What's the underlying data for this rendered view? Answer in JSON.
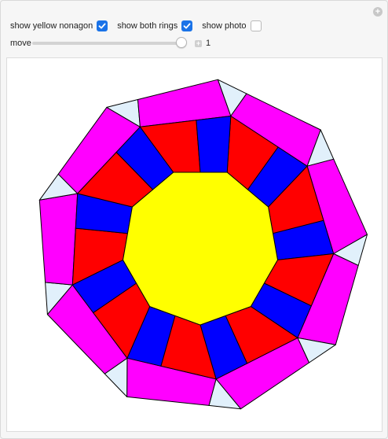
{
  "controls": {
    "nonagon": {
      "label": "show yellow nonagon",
      "checked": true
    },
    "rings": {
      "label": "show both rings",
      "checked": true
    },
    "photo": {
      "label": "show photo",
      "checked": false
    }
  },
  "slider": {
    "label": "move",
    "value": "1",
    "position": 1.0
  },
  "colors": {
    "yellow": "#ffff00",
    "red": "#ff0000",
    "blue": "#0000ff",
    "magenta": "#ff00ff",
    "light_blue": "#e1f0fb",
    "checkbox_accent": "#1a73e8"
  }
}
